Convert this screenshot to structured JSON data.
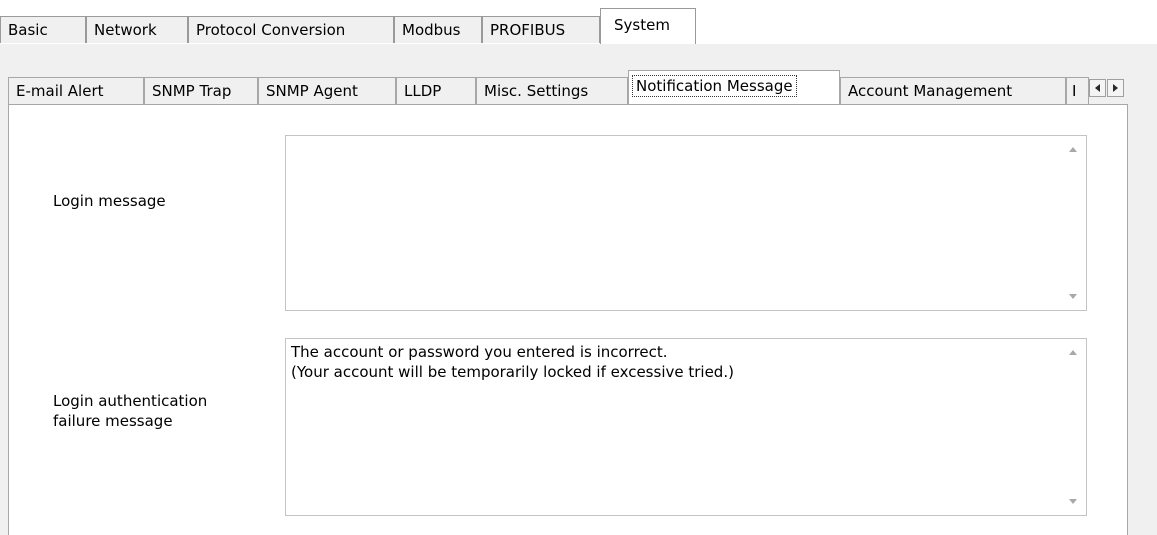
{
  "top_tabs": [
    {
      "label": "Basic"
    },
    {
      "label": "Network"
    },
    {
      "label": "Protocol Conversion"
    },
    {
      "label": "Modbus"
    },
    {
      "label": "PROFIBUS"
    },
    {
      "label": "System"
    }
  ],
  "active_top_tab": "System",
  "sub_tabs": [
    {
      "label": "E-mail Alert"
    },
    {
      "label": "SNMP Trap"
    },
    {
      "label": "SNMP Agent"
    },
    {
      "label": "LLDP"
    },
    {
      "label": "Misc. Settings"
    },
    {
      "label": "Notification Message"
    },
    {
      "label": "Account Management"
    },
    {
      "label": "I"
    }
  ],
  "active_sub_tab": "Notification Message",
  "login_message": {
    "label": "Login message",
    "value": ""
  },
  "login_failure_message": {
    "label_line1": "Login authentication",
    "label_line2": "failure message",
    "value": "The account or password you entered is incorrect.\n(Your account will be temporarily locked if excessive tried.)"
  },
  "icons": {
    "tab_scroll_left": "triangle-left-icon",
    "tab_scroll_right": "triangle-right-icon",
    "scroll_up": "scroll-up-arrow-icon",
    "scroll_down": "scroll-down-arrow-icon"
  }
}
